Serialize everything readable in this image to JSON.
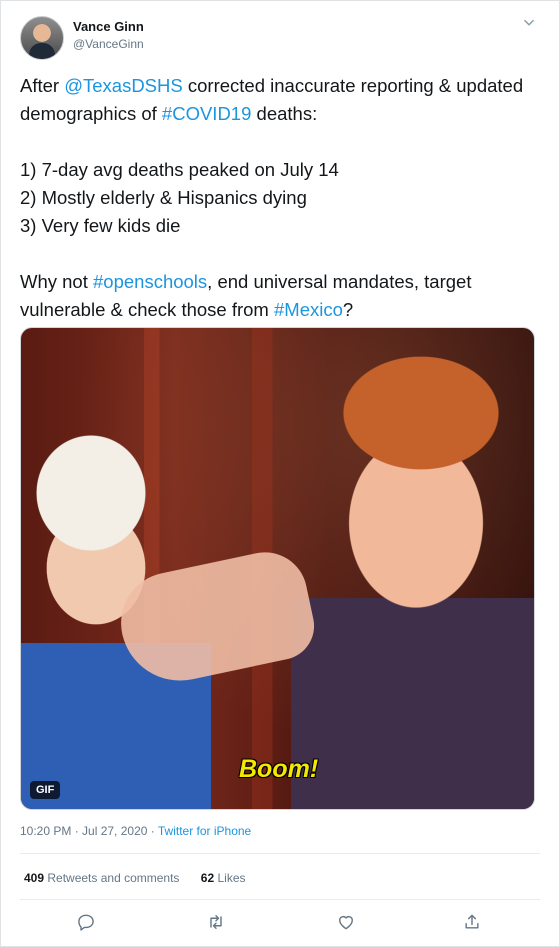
{
  "tweet": {
    "author_name": "Vance Ginn",
    "author_handle": "@VanceGinn",
    "text_parts": {
      "p1a": "After ",
      "mention": "@TexasDSHS",
      "p1b": " corrected inaccurate reporting & updated demographics of ",
      "hashtag1": "#COVID19",
      "p1c": " deaths:\n\n1) 7-day avg deaths peaked on July 14\n2) Mostly elderly & Hispanics dying\n3) Very few kids die\n\nWhy not ",
      "hashtag2": "#openschools",
      "p1d": ", end universal mandates, target vulnerable & check those from ",
      "hashtag3": "#Mexico",
      "p1e": "?"
    },
    "media": {
      "caption": "Boom!",
      "badge": "GIF"
    },
    "timestamp": "10:20 PM · Jul 27, 2020 · ",
    "source": "Twitter for iPhone",
    "retweets_count": "409",
    "retweets_label": " Retweets and comments",
    "likes_count": "62",
    "likes_label": " Likes"
  },
  "icons": {
    "menu": "chevron-down-icon",
    "reply": "reply-icon",
    "retweet": "retweet-icon",
    "like": "heart-icon",
    "share": "share-icon"
  },
  "colors": {
    "link": "#1b95e0",
    "caption": "#f3e900",
    "muted": "#657786"
  }
}
